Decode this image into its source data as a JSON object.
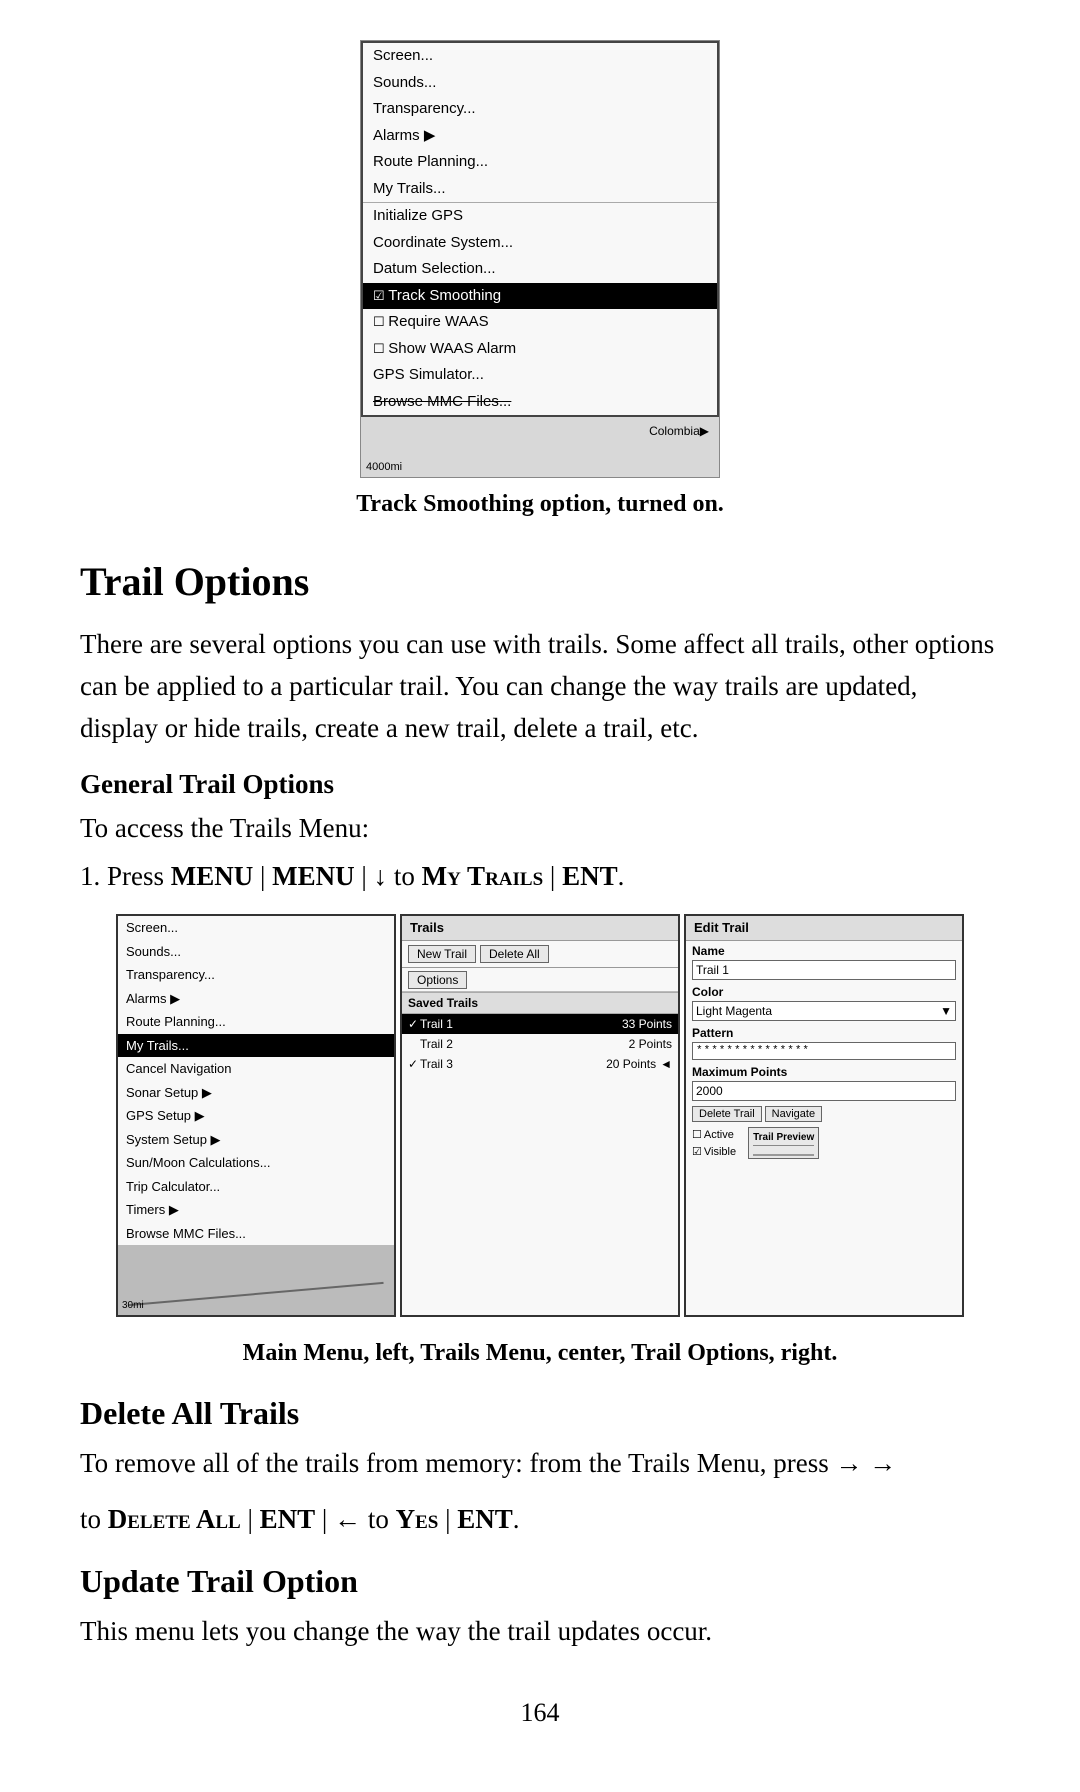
{
  "top_screenshot": {
    "caption": "Track Smoothing option, turned on.",
    "menu_items": [
      {
        "label": "Screen...",
        "type": "normal"
      },
      {
        "label": "Sounds...",
        "type": "normal"
      },
      {
        "label": "Transparency...",
        "type": "normal"
      },
      {
        "label": "Alarms",
        "type": "arrow"
      },
      {
        "label": "Route Planning...",
        "type": "normal"
      },
      {
        "label": "My Trails...",
        "type": "normal"
      },
      {
        "label": "Initialize GPS",
        "type": "separator"
      },
      {
        "label": "Coordinate System...",
        "type": "normal"
      },
      {
        "label": "Datum Selection...",
        "type": "normal"
      },
      {
        "label": "Track Smoothing",
        "type": "highlighted-checked"
      },
      {
        "label": "Require WAAS",
        "type": "checkbox-unchecked"
      },
      {
        "label": "Show WAAS Alarm",
        "type": "checkbox-unchecked"
      },
      {
        "label": "GPS Simulator...",
        "type": "normal"
      },
      {
        "label": "Browse MMC Files...",
        "type": "strikethrough"
      }
    ],
    "map_scale": "4000mi",
    "map_country": "Colombia"
  },
  "section_title": "Trail Options",
  "body_paragraph": "There are several options you can use with trails. Some affect all trails, other options can be applied to a particular trail. You can change the way trails are updated, display or hide trails, create a new trail, delete a trail, etc.",
  "general_trail_options_heading": "General Trail Options",
  "to_access_text": "To access the Trails Menu:",
  "step1_text": "1. Press",
  "step1_menu": "MENU",
  "step1_sep1": " | ",
  "step1_menu2": "MENU",
  "step1_sep2": " | ↓ to ",
  "step1_mytrails": "My Trails",
  "step1_sep3": " | ",
  "step1_ent": "ENT",
  "step1_period": ".",
  "left_panel": {
    "items": [
      {
        "label": "Screen...",
        "type": "normal"
      },
      {
        "label": "Sounds...",
        "type": "normal"
      },
      {
        "label": "Transparency...",
        "type": "normal"
      },
      {
        "label": "Alarms",
        "type": "arrow"
      },
      {
        "label": "Route Planning...",
        "type": "normal"
      },
      {
        "label": "My Trails...",
        "type": "highlighted"
      },
      {
        "label": "Cancel Navigation",
        "type": "normal"
      },
      {
        "label": "Sonar Setup",
        "type": "arrow"
      },
      {
        "label": "GPS Setup",
        "type": "arrow"
      },
      {
        "label": "System Setup",
        "type": "arrow"
      },
      {
        "label": "Sun/Moon Calculations...",
        "type": "normal"
      },
      {
        "label": "Trip Calculator...",
        "type": "normal"
      },
      {
        "label": "Timers",
        "type": "arrow"
      },
      {
        "label": "Browse MMC Files...",
        "type": "normal"
      }
    ],
    "map_scale": "30mi"
  },
  "center_panel": {
    "header": "Trails",
    "btn_new_trail": "New Trail",
    "btn_delete_all": "Delete All",
    "btn_options": "Options",
    "saved_trails_label": "Saved Trails",
    "trails": [
      {
        "check": "✓",
        "name": "Trail 1",
        "points": "33 Points",
        "highlighted": true
      },
      {
        "check": "",
        "name": "Trail 2",
        "points": "2 Points",
        "highlighted": false
      },
      {
        "check": "✓",
        "name": "Trail 3",
        "points": "20 Points",
        "highlighted": false,
        "arrow": "◄"
      }
    ]
  },
  "right_panel": {
    "header": "Edit Trail",
    "name_label": "Name",
    "name_value": "Trail 1",
    "color_label": "Color",
    "color_value": "Light Magenta",
    "pattern_label": "Pattern",
    "pattern_value": "***************",
    "max_points_label": "Maximum Points",
    "max_points_value": "2000",
    "btn_delete_trail": "Delete Trail",
    "btn_navigate": "Navigate",
    "cb_active_label": "Active",
    "cb_active_checked": false,
    "cb_visible_label": "Visible",
    "cb_visible_checked": true,
    "trail_preview_label": "Trail Preview"
  },
  "three_panel_caption": "Main Menu, left, Trails Menu, center, Trail Options, right.",
  "delete_all_title": "Delete All Trails",
  "delete_all_text": "To remove all of the trails from memory: from the Trails Menu, press →",
  "delete_all_text2": "to",
  "delete_all_bold1": "Delete All",
  "delete_all_sep1": " | ",
  "delete_all_ent1": "ENT",
  "delete_all_sep2": " | ← to ",
  "delete_all_yes": "Yes",
  "delete_all_sep3": " | ",
  "delete_all_ent2": "ENT",
  "delete_all_end": ".",
  "update_title": "Update Trail Option",
  "update_text": "This menu lets you change the way the trail updates occur.",
  "page_number": "164"
}
